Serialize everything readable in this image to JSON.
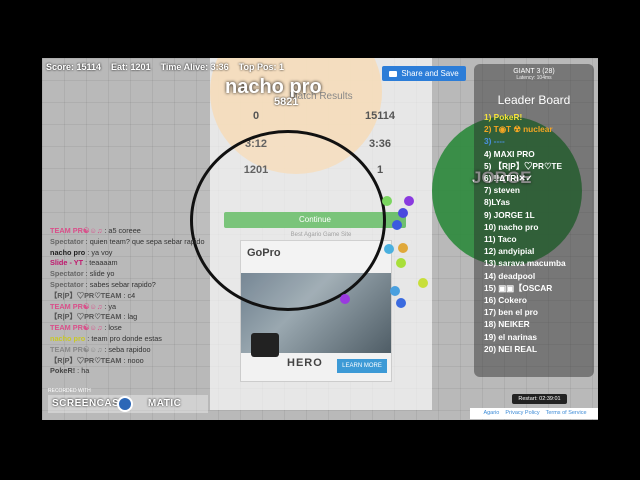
{
  "hud": {
    "score": "Score: 15114",
    "eat": "Eat: 1201",
    "time_alive": "Time Alive: 3:36",
    "top_pos": "Top Pos: 1"
  },
  "player": {
    "name": "nacho pro",
    "mass": "5821"
  },
  "enemy_cell": {
    "name": "JORGE"
  },
  "stats_modal": {
    "title": "Match Results",
    "stats": [
      {
        "value": "0",
        "label": ""
      },
      {
        "value": "15114",
        "label": ""
      },
      {
        "value": "3:12",
        "label": ""
      },
      {
        "value": "3:36",
        "label": ""
      },
      {
        "value": "1201",
        "label": ""
      },
      {
        "value": "1",
        "label": ""
      }
    ],
    "continue_label": "Continue",
    "sponsor_text": "Best Agario Game Site",
    "ad": {
      "brand": "GoPro",
      "product": "HERO",
      "learn_more": "LEARN MORE"
    }
  },
  "share_button": {
    "label": "Share and Save"
  },
  "chat": [
    {
      "name": "TEAM PR☯☺♫",
      "text": " : a5 coreee",
      "color": "#d94f8a"
    },
    {
      "name": "Spectator",
      "text": " : quien team? que sepa sebar rapido",
      "color": "#666666"
    },
    {
      "name": "nacho pro",
      "text": " : ya voy",
      "color": "#222222"
    },
    {
      "name": "Slide - YT",
      "text": " : teaaaam",
      "color": "#c0166d"
    },
    {
      "name": "Spectator",
      "text": " : slide yo",
      "color": "#666666"
    },
    {
      "name": "Spectator",
      "text": " : sabes sebar rapido?",
      "color": "#666666"
    },
    {
      "name": "【R|P】♡PR♡TEAM",
      "text": " : c4",
      "color": "#555555"
    },
    {
      "name": "TEAM PR☯☺♫",
      "text": " : ya",
      "color": "#d94f8a"
    },
    {
      "name": "【R|P】♡PR♡TEAM",
      "text": " : lag",
      "color": "#555555"
    },
    {
      "name": "TEAM PR☯☺♫",
      "text": " : lose",
      "color": "#d94f8a"
    },
    {
      "name": "nacho pro",
      "text": " : team pro donde estas",
      "color": "#c8c82a"
    },
    {
      "name": "TEAM PR☯☺♫",
      "text": " : seba rapidoo",
      "color": "#888888"
    },
    {
      "name": "【R|P】♡PR♡TEAM",
      "text": " : nooo",
      "color": "#555555"
    },
    {
      "name": "PokeR!",
      "text": " : ha",
      "color": "#444444"
    }
  ],
  "leaderboard": {
    "server": "GIANT 3  (28)",
    "latency": "Latency: 104ms",
    "title": "Leader Board",
    "rows": [
      {
        "text": "1) PokeR!",
        "color": "#f5e23a"
      },
      {
        "text": "2) T◉T ☢ nuclear",
        "color": "#f5a623"
      },
      {
        "text": "3) ----",
        "color": "#4a90e2"
      },
      {
        "text": "4) MAXI PRO",
        "color": "#ffffff"
      },
      {
        "text": "5) 【R|P】♡PR♡TE",
        "color": "#ffffff"
      },
      {
        "text": "6) !!ΔTRI✕✓",
        "color": "#ffffff"
      },
      {
        "text": "7) steven",
        "color": "#ffffff"
      },
      {
        "text": "8)LYas",
        "color": "#ffffff"
      },
      {
        "text": "9) JORGE 1L",
        "color": "#ffffff"
      },
      {
        "text": "10) nacho pro",
        "color": "#ffffff"
      },
      {
        "text": "11) Taco",
        "color": "#ffffff"
      },
      {
        "text": "12) andyipial",
        "color": "#ffffff"
      },
      {
        "text": "13) sarava macumba",
        "color": "#ffffff"
      },
      {
        "text": "14) deadpool",
        "color": "#ffffff"
      },
      {
        "text": "15) ▣▣【OSCAR",
        "color": "#ffffff"
      },
      {
        "text": "16) Cokero",
        "color": "#ffffff"
      },
      {
        "text": "17) ben el pro",
        "color": "#ffffff"
      },
      {
        "text": "18) NEIKER",
        "color": "#ffffff"
      },
      {
        "text": "19) el narinas",
        "color": "#ffffff"
      },
      {
        "text": "20) NEI REAL",
        "color": "#ffffff"
      }
    ]
  },
  "restart": "Restart: 02:39:01",
  "footer": {
    "links": [
      "Agario",
      "Privacy Policy",
      "Terms of Service"
    ]
  },
  "watermark": {
    "top": "RECORDED WITH",
    "left": "SCREENCAST",
    "right": "MATIC"
  }
}
